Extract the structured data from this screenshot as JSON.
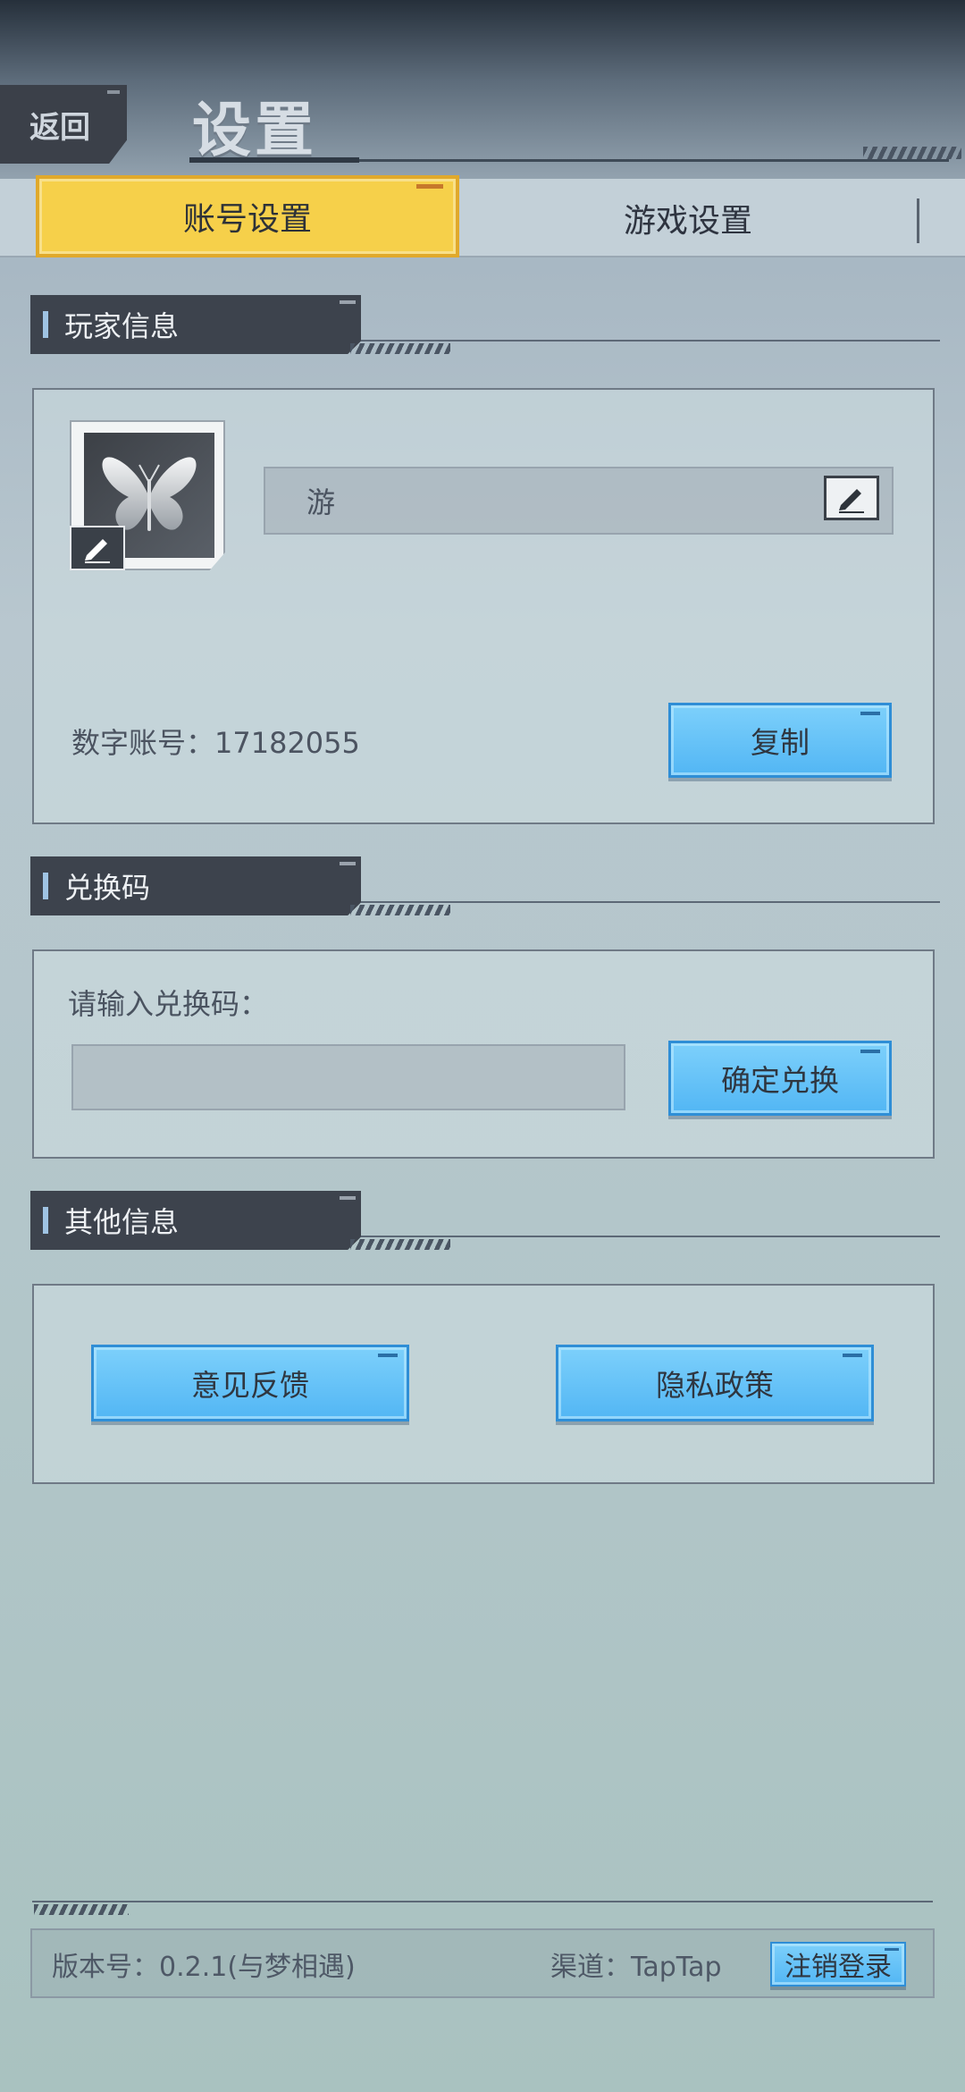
{
  "header": {
    "back_label": "返回",
    "title": "设置"
  },
  "tabs": [
    {
      "label": "账号设置",
      "active": true
    },
    {
      "label": "游戏设置",
      "active": false
    }
  ],
  "player_info": {
    "section_title": "玩家信息",
    "nickname": "游",
    "account_label": "数字账号：17182055",
    "copy_label": "复制"
  },
  "redeem": {
    "section_title": "兑换码",
    "prompt": "请输入兑换码：",
    "input_value": "",
    "confirm_label": "确定兑换"
  },
  "other_info": {
    "section_title": "其他信息",
    "feedback_label": "意见反馈",
    "privacy_label": "隐私政策"
  },
  "footer": {
    "version": "版本号：0.2.1(与梦相遇)",
    "channel": "渠道：TapTap",
    "logout_label": "注销登录"
  },
  "colors": {
    "tab_active": "#f6d04a",
    "button_blue": "#5cbcf6",
    "section_header": "#3d434d"
  },
  "icons": [
    "edit-icon",
    "butterfly-icon"
  ]
}
